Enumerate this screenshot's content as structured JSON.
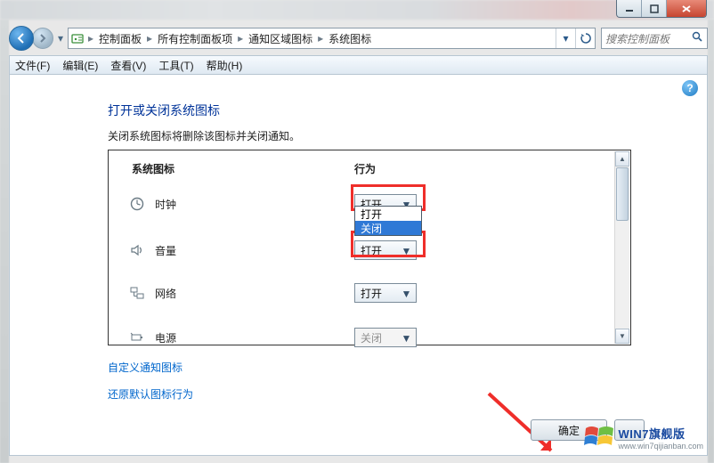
{
  "window": {
    "minimize_tip": "最小化",
    "maximize_tip": "最大化",
    "close_tip": "关闭"
  },
  "breadcrumb": {
    "items": [
      "控制面板",
      "所有控制面板项",
      "通知区域图标",
      "系统图标"
    ]
  },
  "search": {
    "placeholder": "搜索控制面板"
  },
  "menu": {
    "file": "文件(F)",
    "edit": "编辑(E)",
    "view": "查看(V)",
    "tools": "工具(T)",
    "help": "帮助(H)"
  },
  "page": {
    "heading": "打开或关闭系统图标",
    "subtext": "关闭系统图标将删除该图标并关闭通知。",
    "col_icon": "系统图标",
    "col_behavior": "行为"
  },
  "rows": {
    "clock": {
      "label": "时钟",
      "value": "打开"
    },
    "volume": {
      "label": "音量",
      "value": "打开"
    },
    "network": {
      "label": "网络",
      "value": "打开"
    },
    "power": {
      "label": "电源",
      "value": "关闭"
    }
  },
  "dropdown": {
    "opt_on": "打开",
    "opt_off": "关闭"
  },
  "links": {
    "customize": "自定义通知图标",
    "restore": "还原默认图标行为"
  },
  "buttons": {
    "ok": "确定",
    "cancel": "取消"
  },
  "watermark": {
    "line1": "WIN7旗舰版",
    "line2": "www.win7qijianban.com"
  }
}
